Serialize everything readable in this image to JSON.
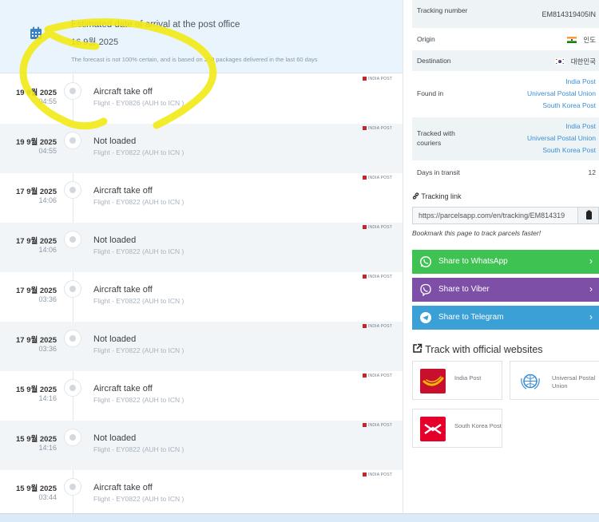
{
  "eta": {
    "title": "Estimated date of arrival at the post office",
    "date": "16 9월 2025",
    "note": "The forecast is not 100% certain, and is based on 250 packages delivered in the last 60 days"
  },
  "events": [
    {
      "date": "19 9월 2025",
      "time": "04:55",
      "status": "Aircraft take off",
      "desc": "Flight - EY0826 (AUH to ICN )",
      "badge": "INDIA POST"
    },
    {
      "date": "19 9월 2025",
      "time": "04:55",
      "status": "Not loaded",
      "desc": "Flight - EY0822 (AUH to ICN )",
      "badge": "INDIA POST"
    },
    {
      "date": "17 9월 2025",
      "time": "14:06",
      "status": "Aircraft take off",
      "desc": "Flight - EY0822 (AUH to ICN )",
      "badge": "INDIA POST"
    },
    {
      "date": "17 9월 2025",
      "time": "14:06",
      "status": "Not loaded",
      "desc": "Flight - EY0822 (AUH to ICN )",
      "badge": "INDIA POST"
    },
    {
      "date": "17 9월 2025",
      "time": "03:36",
      "status": "Aircraft take off",
      "desc": "Flight - EY0822 (AUH to ICN )",
      "badge": "INDIA POST"
    },
    {
      "date": "17 9월 2025",
      "time": "03:36",
      "status": "Not loaded",
      "desc": "Flight - EY0822 (AUH to ICN )",
      "badge": "INDIA POST"
    },
    {
      "date": "15 9월 2025",
      "time": "14:16",
      "status": "Aircraft take off",
      "desc": "Flight - EY0822 (AUH to ICN )",
      "badge": "INDIA POST"
    },
    {
      "date": "15 9월 2025",
      "time": "14:16",
      "status": "Not loaded",
      "desc": "Flight - EY0822 (AUH to ICN )",
      "badge": "INDIA POST"
    },
    {
      "date": "15 9월 2025",
      "time": "03:44",
      "status": "Aircraft take off",
      "desc": "Flight - EY0822 (AUH to ICN )",
      "badge": "INDIA POST"
    }
  ],
  "info": {
    "tracking_label": "Tracking number",
    "tracking_value": "EM814319405IN",
    "origin_label": "Origin",
    "origin_value": "인도",
    "destination_label": "Destination",
    "destination_value": "대한민국",
    "found_label": "Found in",
    "found_values": [
      "India Post",
      "Universal Postal Union",
      "South Korea Post"
    ],
    "couriers_label": "Tracked with couriers",
    "couriers_values": [
      "India Post",
      "Universal Postal Union",
      "South Korea Post"
    ],
    "days_label": "Days in transit",
    "days_value": "12"
  },
  "tracking_link": {
    "label": "Tracking link",
    "url": "https://parcelsapp.com/en/tracking/EM814319",
    "bookmark": "Bookmark this page to track parcels faster!"
  },
  "share": {
    "whatsapp": "Share to WhatsApp",
    "viber": "Share to Viber",
    "telegram": "Share to Telegram"
  },
  "official": {
    "title": "Track with official websites",
    "sites": [
      "India Post",
      "Universal Postal Union",
      "South Korea Post"
    ]
  },
  "colors": {
    "eta_bg": "#e9f4fc",
    "row_alt": "#eef3f6",
    "link": "#3b8fd6",
    "whatsapp": "#3ec252",
    "viber": "#7d4fa6",
    "telegram": "#3aa0d6",
    "scribble": "#f2ea15"
  }
}
